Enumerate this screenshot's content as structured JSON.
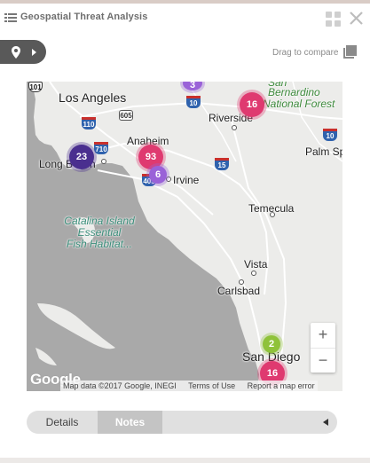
{
  "header": {
    "title": "Geospatial Threat Analysis",
    "list_icon": "list-icon",
    "dashboard_icon": "dashboard-icon",
    "close_icon": "close-icon"
  },
  "toolbar": {
    "location_icon": "map-pin-icon",
    "expand_icon": "chevron-right-icon",
    "drag_label": "Drag to compare",
    "drag_icon": "copy-icon"
  },
  "map": {
    "places": {
      "los_angeles": "Los Angeles",
      "san_bernardino": "San",
      "san_bernardino_2": "Bernardino",
      "national_forest": "National Forest",
      "riverside": "Riverside",
      "anaheim": "Anaheim",
      "palm_springs": "Palm Sp",
      "long_beach_prefix": "Long B",
      "long_beach_suffix": "ch",
      "irvine": "Irvine",
      "temecula": "Temecula",
      "catalina_1": "Catalina Island",
      "catalina_2": "Essential",
      "catalina_3": "Fish Habitat...",
      "vista": "Vista",
      "carlsbad": "Carlsbad",
      "san_diego": "San Diego"
    },
    "shields": {
      "us101": "101",
      "i10_w": "10",
      "i10_e": "10",
      "i10_far": "10",
      "r605": "605",
      "i110": "110",
      "i710": "710",
      "i15": "15",
      "i405": "405"
    },
    "clusters": [
      {
        "count": "3",
        "color": "#9a62d8"
      },
      {
        "count": "16",
        "color": "#df3a70"
      },
      {
        "count": "23",
        "color": "#4a2f8f"
      },
      {
        "count": "93",
        "color": "#df3a70"
      },
      {
        "count": "6",
        "color": "#9a62d8"
      },
      {
        "count": "2",
        "color": "#8fc23a"
      },
      {
        "count": "16",
        "color": "#df3a70"
      }
    ],
    "zoom_in": "+",
    "zoom_out": "−",
    "logo": "Google",
    "attribution": {
      "data": "Map data ©2017 Google, INEGI",
      "terms": "Terms of Use",
      "report": "Report a map error"
    }
  },
  "tabs": {
    "details": "Details",
    "notes": "Notes",
    "active": "Notes",
    "arrow_icon": "caret-left-icon"
  }
}
